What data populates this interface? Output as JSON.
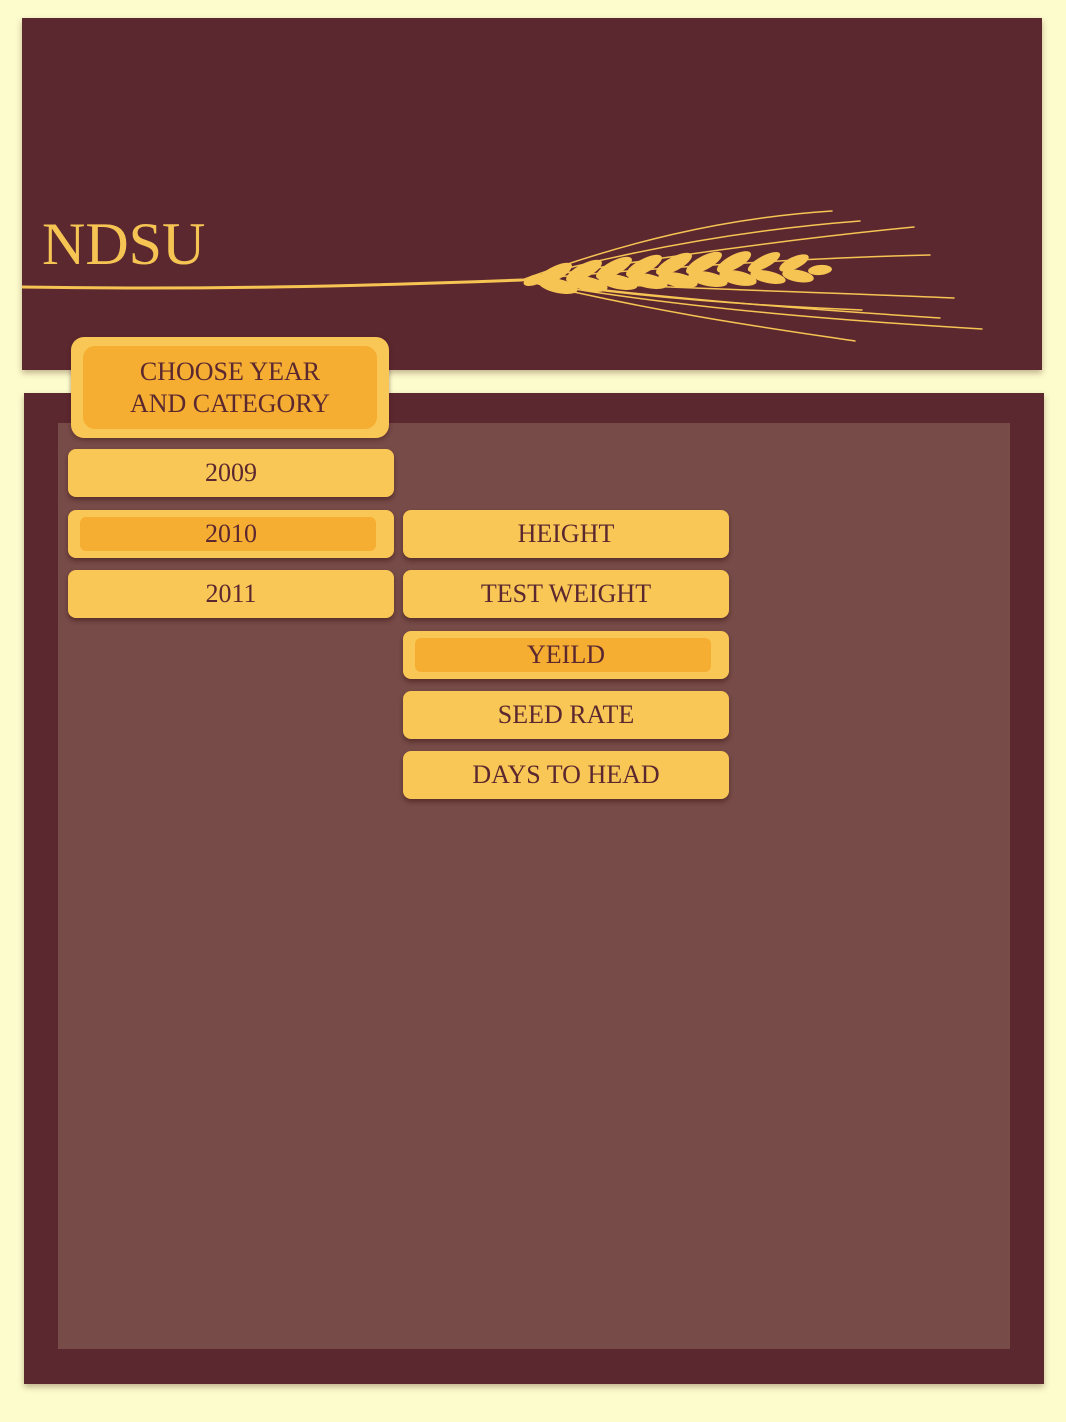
{
  "header": {
    "logo": "NDSU"
  },
  "chooser": {
    "line1": "CHOOSE YEAR",
    "line2": "AND CATEGORY"
  },
  "years": [
    {
      "label": "2009",
      "selected": false
    },
    {
      "label": "2010",
      "selected": true
    },
    {
      "label": "2011",
      "selected": false
    }
  ],
  "categories": [
    {
      "label": "HEIGHT",
      "selected": false
    },
    {
      "label": "TEST WEIGHT",
      "selected": false
    },
    {
      "label": "YEILD",
      "selected": true
    },
    {
      "label": "SEED RATE",
      "selected": false
    },
    {
      "label": "DAYS TO HEAD",
      "selected": false
    }
  ],
  "colors": {
    "background": "#fdfccd",
    "maroon": "#5c2830",
    "panel_inner": "#774b47",
    "gold": "#f9c755",
    "gold_selected": "#f5ae32"
  },
  "icons": {
    "wheat": "wheat-stalk-icon"
  }
}
